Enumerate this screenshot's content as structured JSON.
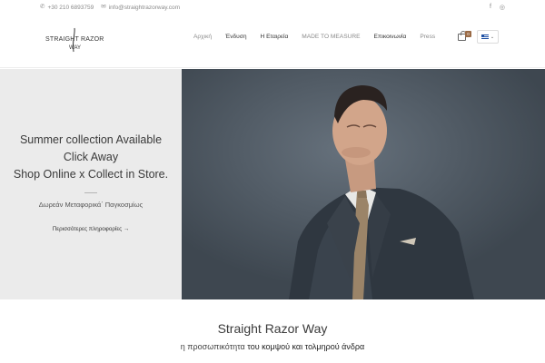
{
  "topbar": {
    "phone": "+30 210 6893759",
    "email": "info@straightrazorway.com",
    "icons": {
      "phone": "phone-icon",
      "email": "envelope-icon",
      "facebook": "facebook-icon",
      "instagram": "instagram-icon"
    },
    "facebook_glyph": "f",
    "instagram_glyph": "◎"
  },
  "logo": {
    "line1": "STRAIGHT RAZOR",
    "line2": "WAY"
  },
  "nav": {
    "items": [
      {
        "label": "Αρχική"
      },
      {
        "label": "Ένδυση"
      },
      {
        "label": "Η Εταιρεία"
      },
      {
        "label": "MADE TO MEASURE"
      },
      {
        "label": "Επικοινωνία"
      },
      {
        "label": "Press"
      }
    ],
    "cart_count": "0",
    "language_caret": "⌄"
  },
  "hero": {
    "lines": [
      "Summer collection Available",
      "Click Away",
      "Shop Online x Collect in Store."
    ],
    "subtitle": "Δωρεάν Μεταφορικά΄ Παγκοσμίως",
    "more_link": "Περισσότερες πληροφορίες →"
  },
  "intro": {
    "title": "Straight Razor Way",
    "subtitle_plain": "η προσωπικότητα ",
    "subtitle_bold": "του κομψού και τολμηρού άνδρα"
  },
  "colors": {
    "accent": "#9a6a45",
    "hero_left_bg": "#ebebeb",
    "hero_right_bg": "#535d68"
  }
}
